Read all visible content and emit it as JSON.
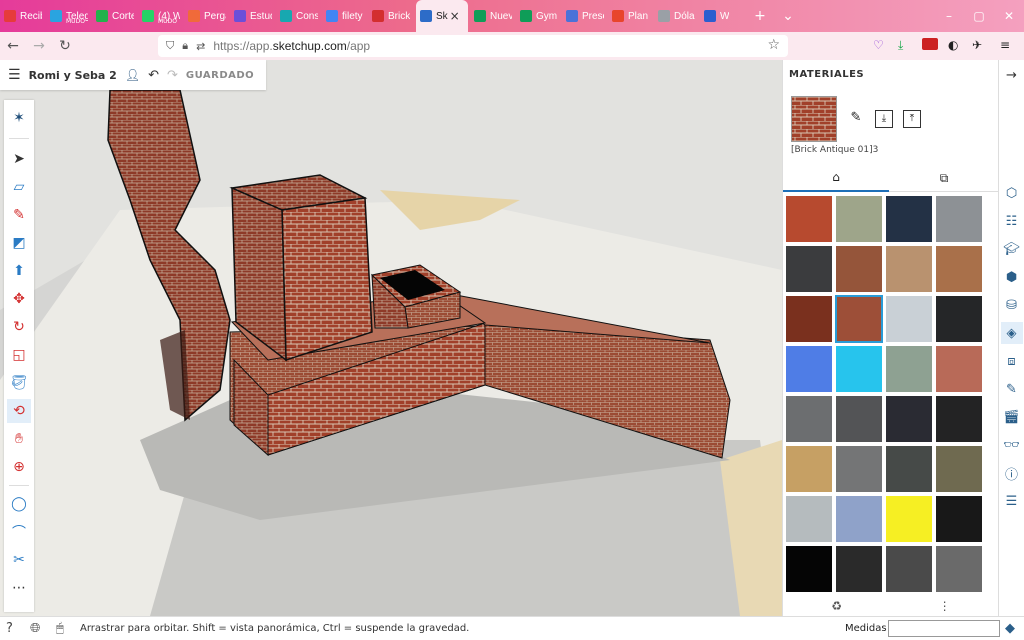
{
  "browser": {
    "tabs": [
      {
        "label": "Recib",
        "color": "#e63b3b"
      },
      {
        "label": "Teleg",
        "sub": "MUDO",
        "color": "#2aa4e0"
      },
      {
        "label": "Corte",
        "color": "#22b24c"
      },
      {
        "label": "(4) W",
        "sub": "MUDO",
        "color": "#25d366"
      },
      {
        "label": "Pergam",
        "color": "#f06a3a"
      },
      {
        "label": "Estud",
        "color": "#6b4fd8"
      },
      {
        "label": "Cons",
        "color": "#18a8b0"
      },
      {
        "label": "filety",
        "color": "#4285f4"
      },
      {
        "label": "Brick",
        "color": "#d32f2f"
      },
      {
        "label": "Sk",
        "color": "#2d6cc8",
        "active": true
      },
      {
        "label": "Nuev",
        "color": "#0f9d58"
      },
      {
        "label": "Gym",
        "color": "#0f9d58"
      },
      {
        "label": "Prese",
        "color": "#4a72d8"
      },
      {
        "label": "Plan",
        "color": "#e8452c"
      },
      {
        "label": "Dóla",
        "color": "#9aa0a6"
      },
      {
        "label": "W",
        "color": "#2b5ecf"
      }
    ],
    "new_tab": "+",
    "tab_list": "⌄",
    "close_tab": "×",
    "url": "https://app.sketchup.com/app",
    "url_plain": "https://app.",
    "url_host": "sketchup.com",
    "url_rest": "/app"
  },
  "app": {
    "project_name": "Romi y Seba 2",
    "saved_label": "GUARDADO"
  },
  "materials": {
    "title": "MATERIALES",
    "current_name": "[Brick Antique 01]3",
    "swatches": [
      "#b74a2f",
      "#9ea58a",
      "#233145",
      "#8d9195",
      "#3b3c3e",
      "#95553a",
      "#b9926f",
      "#a9704a",
      "#7a301e",
      "#9d4f38",
      "#c9d0d6",
      "#252628",
      "#4f7de6",
      "#27c4ed",
      "#8ea192",
      "#b86a58",
      "#6c6e70",
      "#535456",
      "#2a2b33",
      "#232324",
      "#c6a064",
      "#747576",
      "#464a48",
      "#6f6a50",
      "#b5bbbe",
      "#8fa2c9",
      "#f6ef23",
      "#181818",
      "#050505",
      "#2a2a2a",
      "#4a4a4a",
      "#6a6a6a"
    ],
    "selected_index": 9
  },
  "status": {
    "hint": "Arrastrar para orbitar. Shift = vista panorámica, Ctrl = suspende la gravedad.",
    "measures_label": "Medidas",
    "measures_value": ""
  }
}
